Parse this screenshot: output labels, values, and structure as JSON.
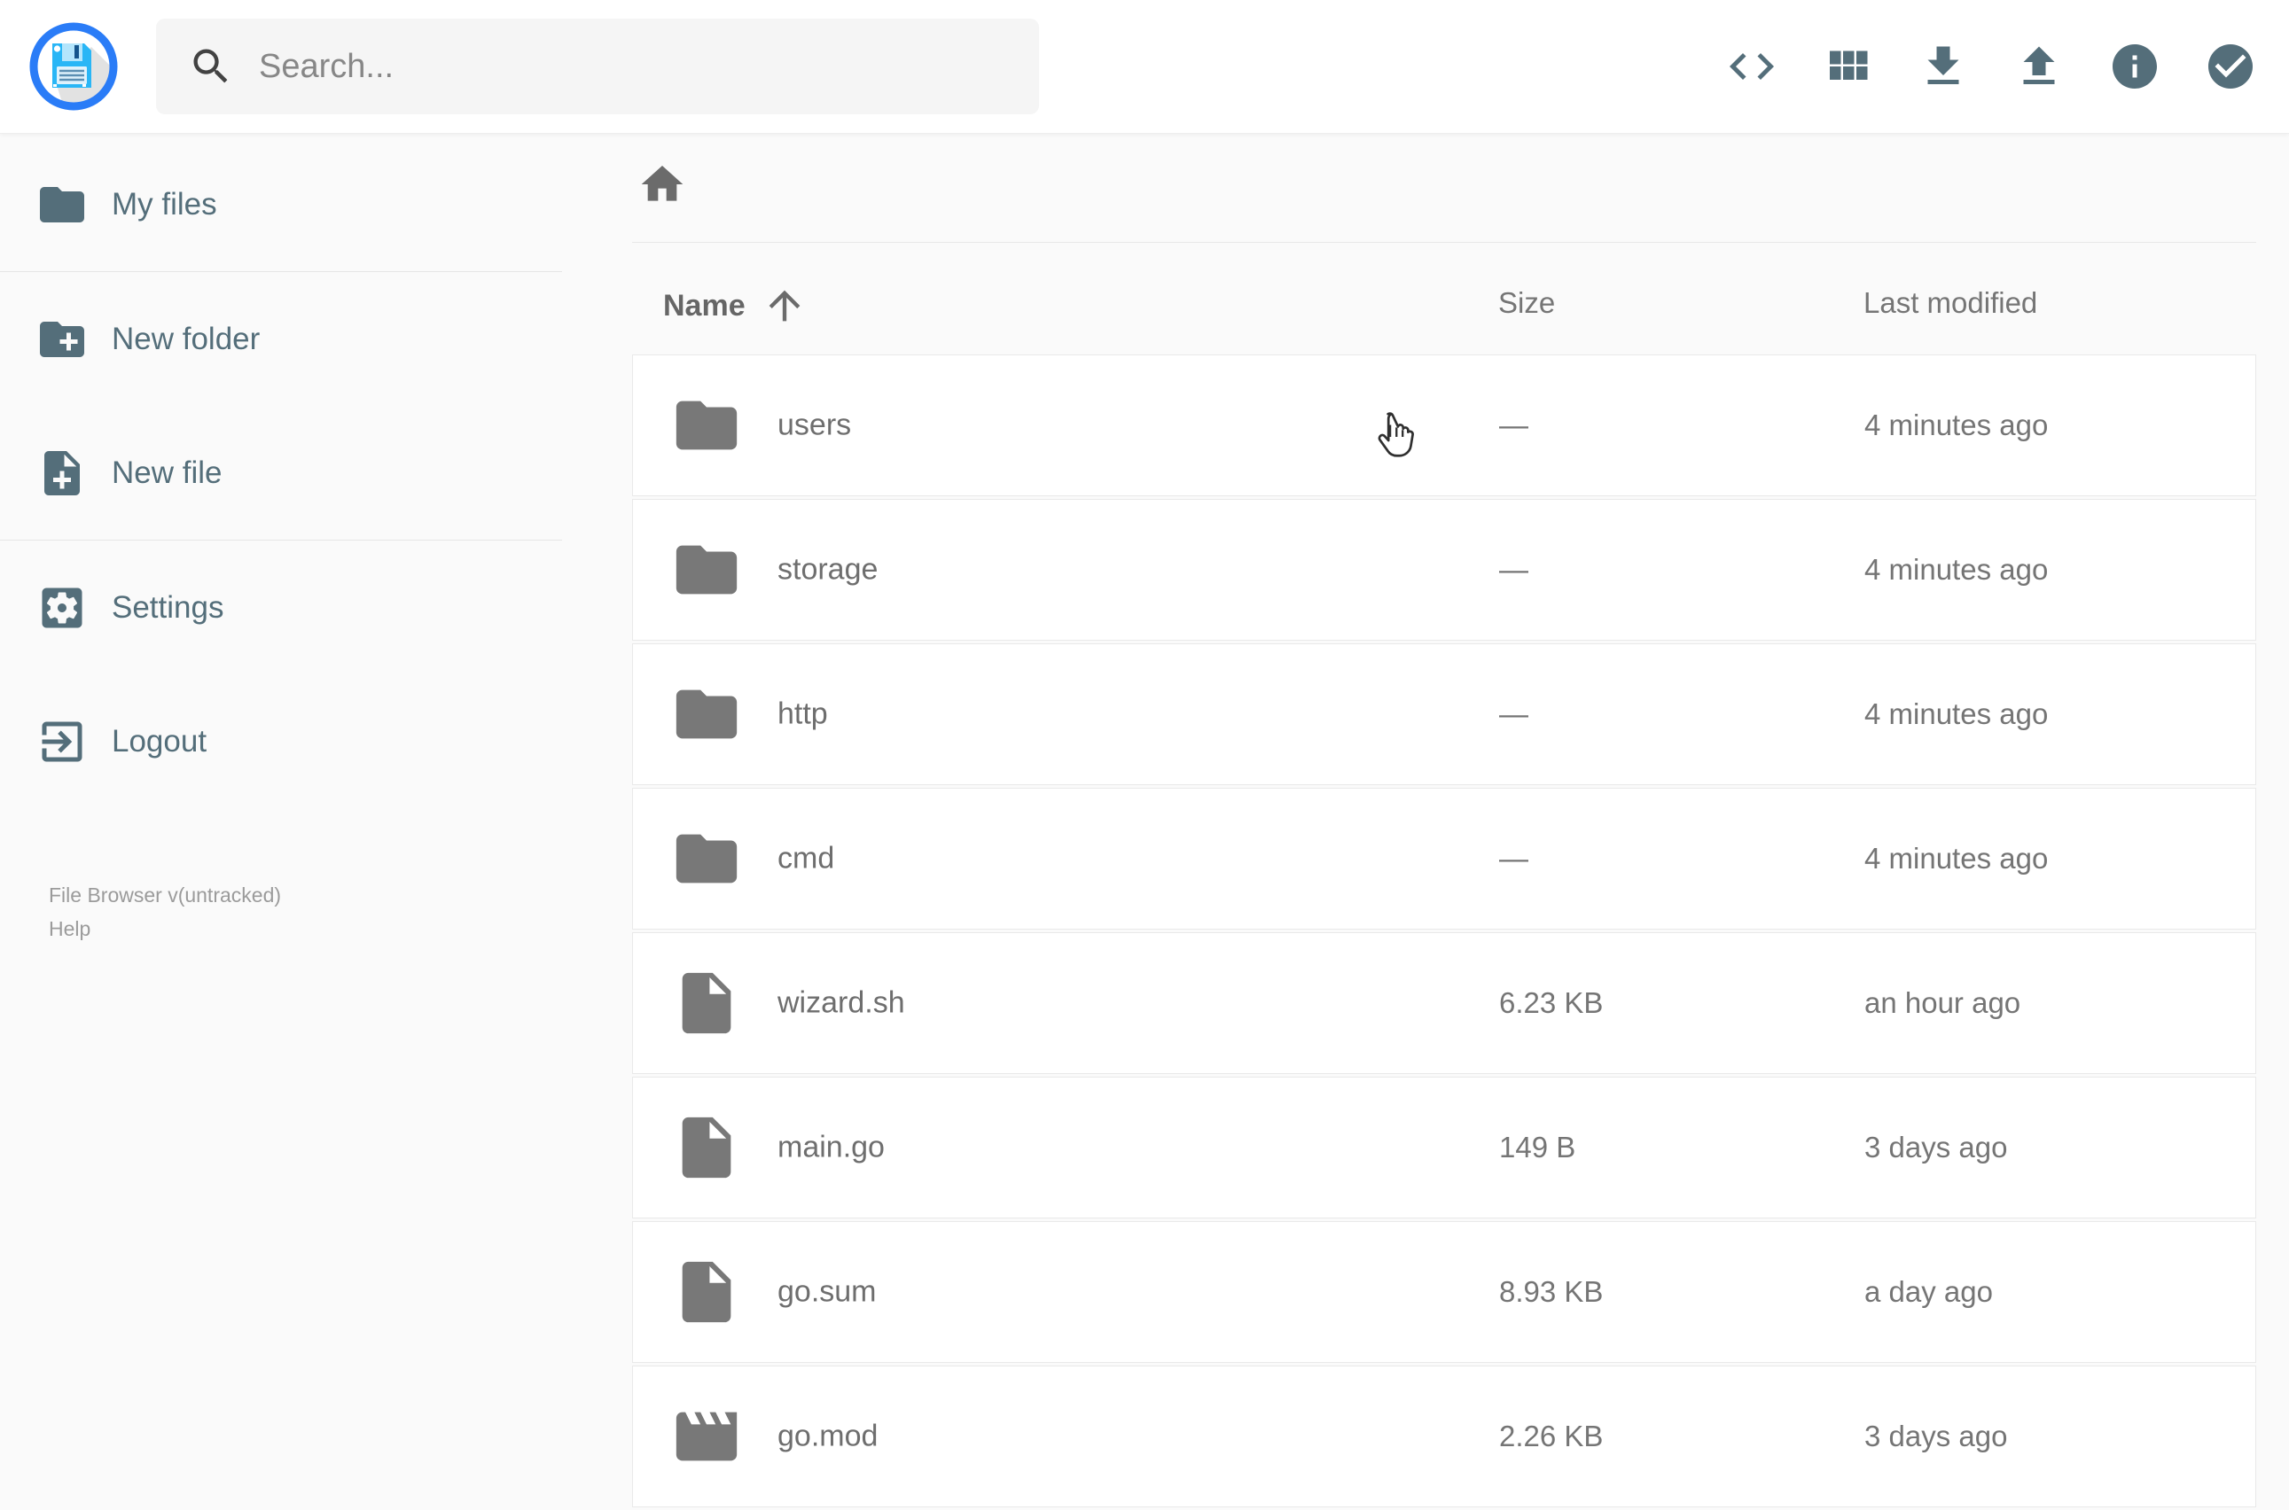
{
  "topbar": {
    "search_placeholder": "Search...",
    "action_icons": [
      "code-icon",
      "grid-view-icon",
      "download-icon",
      "upload-icon",
      "info-icon",
      "select-multiple-icon"
    ]
  },
  "sidebar": {
    "items": [
      {
        "label": "My files",
        "icon": "folder-icon"
      },
      {
        "label": "New folder",
        "icon": "create-new-folder-icon"
      },
      {
        "label": "New file",
        "icon": "note-add-icon"
      },
      {
        "label": "Settings",
        "icon": "settings-icon"
      },
      {
        "label": "Logout",
        "icon": "logout-icon"
      }
    ],
    "footer": {
      "version": "File Browser v(untracked)",
      "help": "Help"
    }
  },
  "main": {
    "breadcrumb_icon": "home-icon",
    "columns": {
      "name": "Name",
      "size": "Size",
      "modified": "Last modified",
      "sort_icon": "arrow-up-icon",
      "sort_direction": "asc"
    },
    "rows": [
      {
        "name": "users",
        "icon": "folder-icon",
        "size": "—",
        "modified": "4 minutes ago"
      },
      {
        "name": "storage",
        "icon": "folder-icon",
        "size": "—",
        "modified": "4 minutes ago"
      },
      {
        "name": "http",
        "icon": "folder-icon",
        "size": "—",
        "modified": "4 minutes ago"
      },
      {
        "name": "cmd",
        "icon": "folder-icon",
        "size": "—",
        "modified": "4 minutes ago"
      },
      {
        "name": "wizard.sh",
        "icon": "file-icon",
        "size": "6.23 KB",
        "modified": "an hour ago"
      },
      {
        "name": "main.go",
        "icon": "file-icon",
        "size": "149 B",
        "modified": "3 days ago"
      },
      {
        "name": "go.sum",
        "icon": "file-icon",
        "size": "8.93 KB",
        "modified": "a day ago"
      },
      {
        "name": "go.mod",
        "icon": "movie-icon",
        "size": "2.26 KB",
        "modified": "3 days ago"
      }
    ]
  },
  "colors": {
    "accent_blue": "#2a7cf7",
    "logo_floppy_blue": "#29b6f6",
    "icon_slate": "#546e7a",
    "row_icon_gray": "#787878",
    "text_gray": "#757575",
    "page_bg": "#fafafa"
  }
}
